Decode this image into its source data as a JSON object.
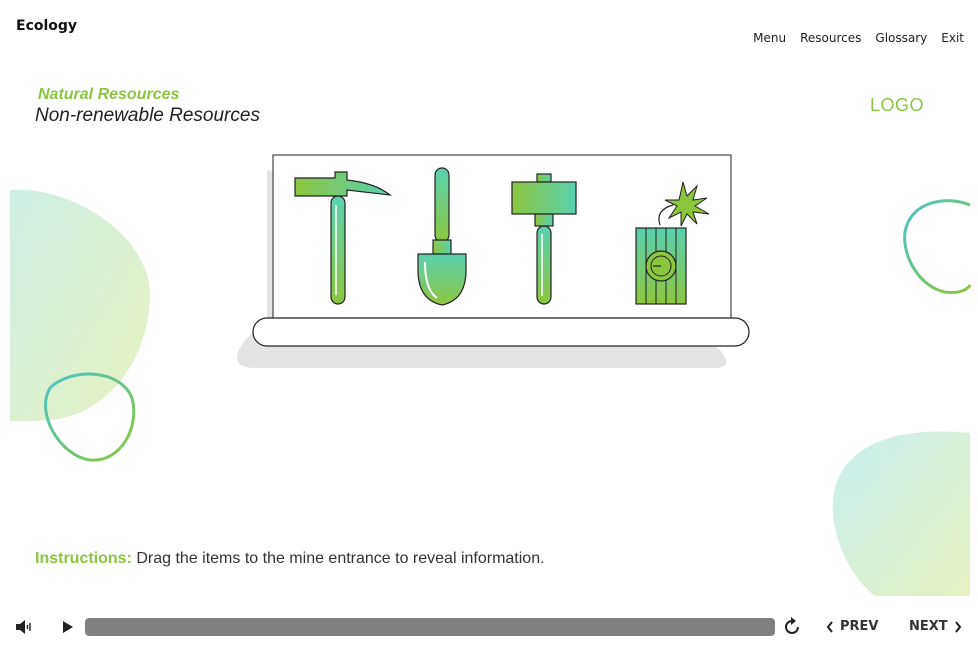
{
  "header": {
    "course_title": "Ecology",
    "nav": [
      "Menu",
      "Resources",
      "Glossary",
      "Exit"
    ]
  },
  "content": {
    "section_title": "Natural Resources",
    "page_title": "Non-renewable Resources",
    "logo": "LOGO",
    "tools": [
      {
        "name": "pickaxe",
        "icon": "pickaxe-icon"
      },
      {
        "name": "shovel",
        "icon": "shovel-icon"
      },
      {
        "name": "sledgehammer",
        "icon": "sledgehammer-icon"
      },
      {
        "name": "dynamite",
        "icon": "dynamite-icon"
      }
    ],
    "instructions": {
      "label": "Instructions:",
      "text": "Drag the items to the mine entrance to reveal information."
    }
  },
  "player": {
    "progress": 1.0,
    "prev_label": "PREV",
    "next_label": "NEXT",
    "icons": {
      "volume": "speaker-icon",
      "play": "play-icon",
      "replay": "replay-icon",
      "prev": "chevron-left-icon",
      "next": "chevron-right-icon"
    }
  },
  "colors": {
    "accent_green": "#8cc63f",
    "accent_teal": "#4cc3c6",
    "progress_fill": "#808080",
    "text_dark": "#222222"
  }
}
